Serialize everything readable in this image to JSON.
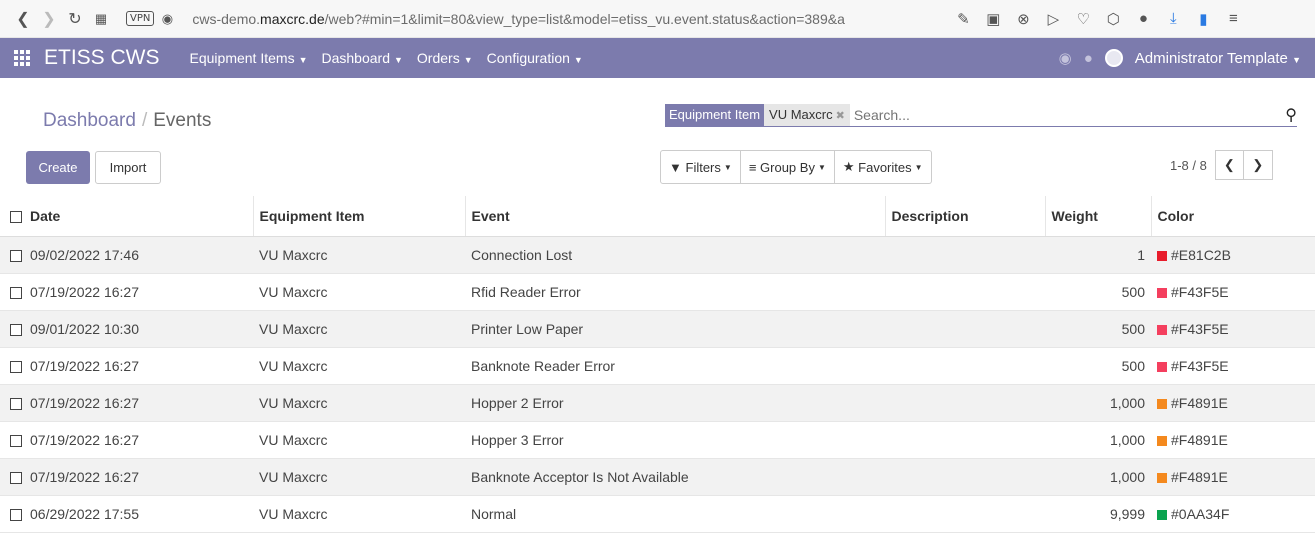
{
  "browser": {
    "url_pre": "cws-demo.",
    "url_host": "maxcrc.de",
    "url_post": "/web?#min=1&limit=80&view_type=list&model=etiss_vu.event.status&action=389&a",
    "vpn": "VPN"
  },
  "navbar": {
    "brand": "ETISS CWS",
    "menus": [
      "Equipment Items",
      "Dashboard",
      "Orders",
      "Configuration"
    ],
    "user": "Administrator Template"
  },
  "breadcrumb": {
    "parent": "Dashboard",
    "sep": "/",
    "current": "Events"
  },
  "buttons": {
    "create": "Create",
    "import": "Import"
  },
  "search": {
    "facet_category": "Equipment Item",
    "facet_value": "VU Maxcrc",
    "placeholder": "Search..."
  },
  "filters": {
    "filters": "Filters",
    "group_by": "Group By",
    "favorites": "Favorites"
  },
  "pager": {
    "text": "1-8 / 8"
  },
  "table": {
    "headers": [
      "Date",
      "Equipment Item",
      "Event",
      "Description",
      "Weight",
      "Color"
    ],
    "rows": [
      {
        "date": "09/02/2022 17:46",
        "item": "VU Maxcrc",
        "event": "Connection Lost",
        "description": "",
        "weight": "1",
        "color": "#E81C2B"
      },
      {
        "date": "07/19/2022 16:27",
        "item": "VU Maxcrc",
        "event": "Rfid Reader Error",
        "description": "",
        "weight": "500",
        "color": "#F43F5E"
      },
      {
        "date": "09/01/2022 10:30",
        "item": "VU Maxcrc",
        "event": "Printer Low Paper",
        "description": "",
        "weight": "500",
        "color": "#F43F5E"
      },
      {
        "date": "07/19/2022 16:27",
        "item": "VU Maxcrc",
        "event": "Banknote Reader Error",
        "description": "",
        "weight": "500",
        "color": "#F43F5E"
      },
      {
        "date": "07/19/2022 16:27",
        "item": "VU Maxcrc",
        "event": "Hopper 2 Error",
        "description": "",
        "weight": "1,000",
        "color": "#F4891E"
      },
      {
        "date": "07/19/2022 16:27",
        "item": "VU Maxcrc",
        "event": "Hopper 3 Error",
        "description": "",
        "weight": "1,000",
        "color": "#F4891E"
      },
      {
        "date": "07/19/2022 16:27",
        "item": "VU Maxcrc",
        "event": "Banknote Acceptor Is Not Available",
        "description": "",
        "weight": "1,000",
        "color": "#F4891E"
      },
      {
        "date": "06/29/2022 17:55",
        "item": "VU Maxcrc",
        "event": "Normal",
        "description": "",
        "weight": "9,999",
        "color": "#0AA34F"
      }
    ]
  },
  "theme": {
    "primary": "#7c7bad"
  }
}
